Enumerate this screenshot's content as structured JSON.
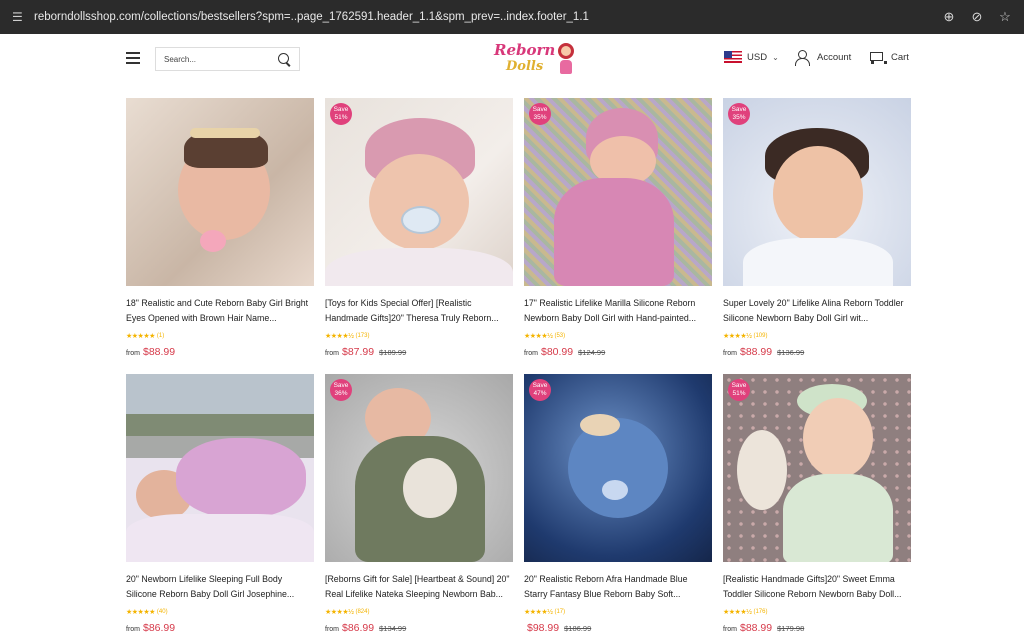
{
  "browser": {
    "url": "reborndollsshop.com/collections/bestsellers?spm=..page_1762591.header_1.1&spm_prev=..index.footer_1.1"
  },
  "header": {
    "search_placeholder": "Search...",
    "logo_line1": "Reborn",
    "logo_line2": "Dolls",
    "currency": "USD",
    "account_label": "Account",
    "cart_label": "Cart"
  },
  "products": [
    {
      "title": "18\" Realistic and Cute Reborn Baby Girl Bright Eyes Opened with Brown Hair Name...",
      "save": "",
      "review_count": "(1)",
      "rating": 5,
      "from": "from",
      "price": "$88.99",
      "compare_price": ""
    },
    {
      "title": "[Toys for Kids Special Offer] [Realistic Handmade Gifts]20\" Theresa Truly Reborn...",
      "save": "Save 51%",
      "review_count": "(173)",
      "rating": 4.5,
      "from": "from",
      "price": "$87.99",
      "compare_price": "$189.99"
    },
    {
      "title": "17\" Realistic Lifelike Marilla Silicone Reborn Newborn Baby Doll Girl with Hand-painted...",
      "save": "Save 35%",
      "review_count": "(53)",
      "rating": 4.5,
      "from": "from",
      "price": "$80.99",
      "compare_price": "$124.99"
    },
    {
      "title": "Super Lovely 20\" Lifelike Alina Reborn Toddler Silicone Newborn Baby Doll Girl wit...",
      "save": "Save 35%",
      "review_count": "(109)",
      "rating": 4.5,
      "from": "from",
      "price": "$88.99",
      "compare_price": "$136.99"
    },
    {
      "title": "20\" Newborn Lifelike Sleeping Full Body Silicone Reborn Baby Doll Girl Josephine...",
      "save": "",
      "review_count": "(40)",
      "rating": 5,
      "from": "from",
      "price": "$86.99",
      "compare_price": ""
    },
    {
      "title": "[Reborns Gift for Sale] [Heartbeat & Sound] 20\" Real Lifelike Nateka Sleeping Newborn Bab...",
      "save": "Save 36%",
      "review_count": "(824)",
      "rating": 4.5,
      "from": "from",
      "price": "$86.99",
      "compare_price": "$134.99"
    },
    {
      "title": "20\" Realistic Reborn Afra Handmade Blue Starry Fantasy Blue Reborn Baby Soft...",
      "save": "Save 47%",
      "review_count": "(17)",
      "rating": 4.5,
      "from": "",
      "price": "$98.99",
      "compare_price": "$186.99"
    },
    {
      "title": "[Realistic Handmade Gifts]20\" Sweet Emma Toddler Silicone Reborn Newborn Baby Doll...",
      "save": "Save 51%",
      "review_count": "(176)",
      "rating": 4.5,
      "from": "from",
      "price": "$88.99",
      "compare_price": "$179.98"
    }
  ]
}
